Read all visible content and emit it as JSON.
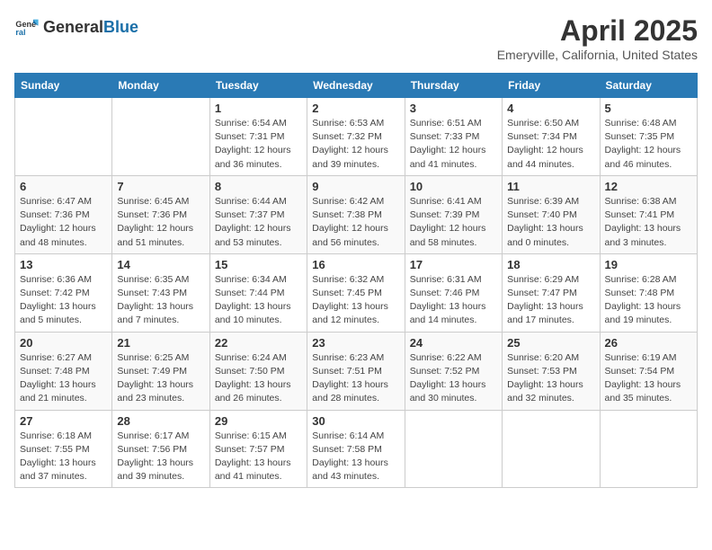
{
  "header": {
    "logo_general": "General",
    "logo_blue": "Blue",
    "month_title": "April 2025",
    "location": "Emeryville, California, United States"
  },
  "weekdays": [
    "Sunday",
    "Monday",
    "Tuesday",
    "Wednesday",
    "Thursday",
    "Friday",
    "Saturday"
  ],
  "weeks": [
    [
      {
        "day": "",
        "info": ""
      },
      {
        "day": "",
        "info": ""
      },
      {
        "day": "1",
        "info": "Sunrise: 6:54 AM\nSunset: 7:31 PM\nDaylight: 12 hours and 36 minutes."
      },
      {
        "day": "2",
        "info": "Sunrise: 6:53 AM\nSunset: 7:32 PM\nDaylight: 12 hours and 39 minutes."
      },
      {
        "day": "3",
        "info": "Sunrise: 6:51 AM\nSunset: 7:33 PM\nDaylight: 12 hours and 41 minutes."
      },
      {
        "day": "4",
        "info": "Sunrise: 6:50 AM\nSunset: 7:34 PM\nDaylight: 12 hours and 44 minutes."
      },
      {
        "day": "5",
        "info": "Sunrise: 6:48 AM\nSunset: 7:35 PM\nDaylight: 12 hours and 46 minutes."
      }
    ],
    [
      {
        "day": "6",
        "info": "Sunrise: 6:47 AM\nSunset: 7:36 PM\nDaylight: 12 hours and 48 minutes."
      },
      {
        "day": "7",
        "info": "Sunrise: 6:45 AM\nSunset: 7:36 PM\nDaylight: 12 hours and 51 minutes."
      },
      {
        "day": "8",
        "info": "Sunrise: 6:44 AM\nSunset: 7:37 PM\nDaylight: 12 hours and 53 minutes."
      },
      {
        "day": "9",
        "info": "Sunrise: 6:42 AM\nSunset: 7:38 PM\nDaylight: 12 hours and 56 minutes."
      },
      {
        "day": "10",
        "info": "Sunrise: 6:41 AM\nSunset: 7:39 PM\nDaylight: 12 hours and 58 minutes."
      },
      {
        "day": "11",
        "info": "Sunrise: 6:39 AM\nSunset: 7:40 PM\nDaylight: 13 hours and 0 minutes."
      },
      {
        "day": "12",
        "info": "Sunrise: 6:38 AM\nSunset: 7:41 PM\nDaylight: 13 hours and 3 minutes."
      }
    ],
    [
      {
        "day": "13",
        "info": "Sunrise: 6:36 AM\nSunset: 7:42 PM\nDaylight: 13 hours and 5 minutes."
      },
      {
        "day": "14",
        "info": "Sunrise: 6:35 AM\nSunset: 7:43 PM\nDaylight: 13 hours and 7 minutes."
      },
      {
        "day": "15",
        "info": "Sunrise: 6:34 AM\nSunset: 7:44 PM\nDaylight: 13 hours and 10 minutes."
      },
      {
        "day": "16",
        "info": "Sunrise: 6:32 AM\nSunset: 7:45 PM\nDaylight: 13 hours and 12 minutes."
      },
      {
        "day": "17",
        "info": "Sunrise: 6:31 AM\nSunset: 7:46 PM\nDaylight: 13 hours and 14 minutes."
      },
      {
        "day": "18",
        "info": "Sunrise: 6:29 AM\nSunset: 7:47 PM\nDaylight: 13 hours and 17 minutes."
      },
      {
        "day": "19",
        "info": "Sunrise: 6:28 AM\nSunset: 7:48 PM\nDaylight: 13 hours and 19 minutes."
      }
    ],
    [
      {
        "day": "20",
        "info": "Sunrise: 6:27 AM\nSunset: 7:48 PM\nDaylight: 13 hours and 21 minutes."
      },
      {
        "day": "21",
        "info": "Sunrise: 6:25 AM\nSunset: 7:49 PM\nDaylight: 13 hours and 23 minutes."
      },
      {
        "day": "22",
        "info": "Sunrise: 6:24 AM\nSunset: 7:50 PM\nDaylight: 13 hours and 26 minutes."
      },
      {
        "day": "23",
        "info": "Sunrise: 6:23 AM\nSunset: 7:51 PM\nDaylight: 13 hours and 28 minutes."
      },
      {
        "day": "24",
        "info": "Sunrise: 6:22 AM\nSunset: 7:52 PM\nDaylight: 13 hours and 30 minutes."
      },
      {
        "day": "25",
        "info": "Sunrise: 6:20 AM\nSunset: 7:53 PM\nDaylight: 13 hours and 32 minutes."
      },
      {
        "day": "26",
        "info": "Sunrise: 6:19 AM\nSunset: 7:54 PM\nDaylight: 13 hours and 35 minutes."
      }
    ],
    [
      {
        "day": "27",
        "info": "Sunrise: 6:18 AM\nSunset: 7:55 PM\nDaylight: 13 hours and 37 minutes."
      },
      {
        "day": "28",
        "info": "Sunrise: 6:17 AM\nSunset: 7:56 PM\nDaylight: 13 hours and 39 minutes."
      },
      {
        "day": "29",
        "info": "Sunrise: 6:15 AM\nSunset: 7:57 PM\nDaylight: 13 hours and 41 minutes."
      },
      {
        "day": "30",
        "info": "Sunrise: 6:14 AM\nSunset: 7:58 PM\nDaylight: 13 hours and 43 minutes."
      },
      {
        "day": "",
        "info": ""
      },
      {
        "day": "",
        "info": ""
      },
      {
        "day": "",
        "info": ""
      }
    ]
  ]
}
